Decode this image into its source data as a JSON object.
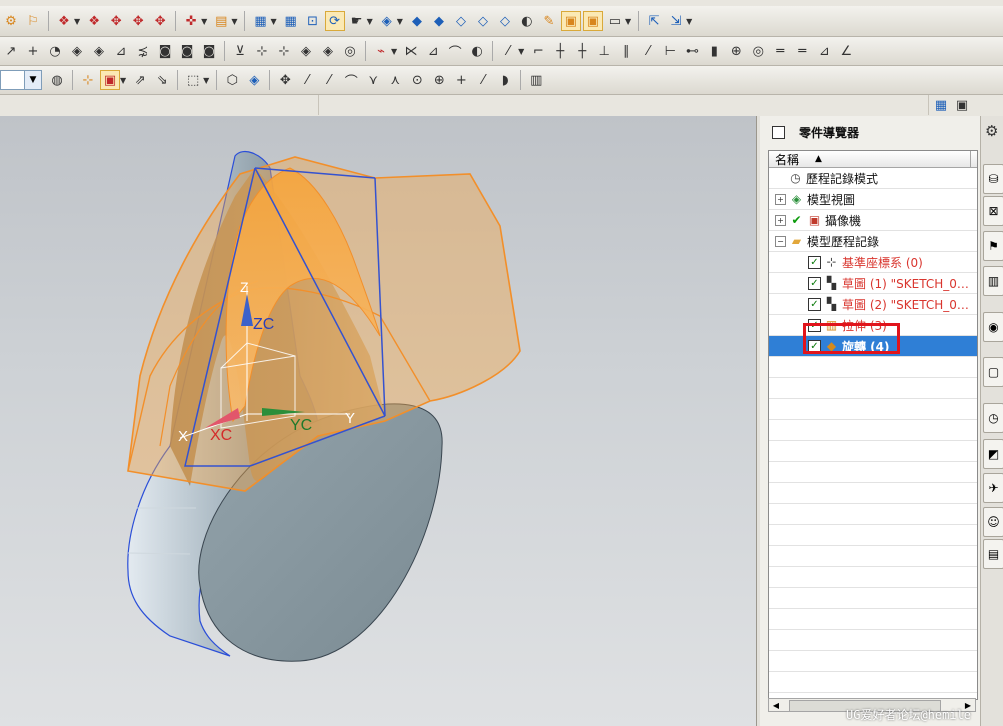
{
  "navigator": {
    "title": "零件導覽器",
    "column_name": "名稱",
    "sort_indicator": "▲",
    "rows": [
      {
        "label": "歷程記錄模式",
        "icon": "clock-icon",
        "expand": "",
        "checked": false,
        "style": "normal"
      },
      {
        "label": "模型視圖",
        "icon": "model-views-icon",
        "expand": "+",
        "checked": false,
        "style": "normal"
      },
      {
        "label": "攝像機",
        "icon": "camera-icon",
        "expand": "+",
        "checked": false,
        "style": "normal"
      },
      {
        "label": "模型歷程記錄",
        "icon": "folder-open-icon",
        "expand": "−",
        "checked": false,
        "style": "normal"
      },
      {
        "label": "基準座標系 (0)",
        "icon": "datum-csys-icon",
        "expand": "",
        "checked": true,
        "style": "red"
      },
      {
        "label": "草圖 (1) \"SKETCH_0…",
        "icon": "sketch-icon",
        "expand": "",
        "checked": true,
        "style": "red"
      },
      {
        "label": "草圖 (2) \"SKETCH_0…",
        "icon": "sketch-icon",
        "expand": "",
        "checked": true,
        "style": "red"
      },
      {
        "label": "拉伸 (3)",
        "icon": "extrude-icon",
        "expand": "",
        "checked": true,
        "style": "red"
      },
      {
        "label": "旋轉 (4)",
        "icon": "revolve-icon",
        "expand": "",
        "checked": true,
        "style": "selected"
      }
    ]
  },
  "viewport": {
    "axis_zc": "ZC",
    "axis_xc": "XC",
    "axis_yc": "YC",
    "axis_x": "X",
    "axis_y": "Y",
    "axis_z": "Z"
  },
  "watermark": "UG爱好者论坛@hemile",
  "colors": {
    "accent_selected": "#2f7fd6",
    "highlight_box": "#e1141b",
    "feature_red_text": "#d9352e",
    "revolve_preview": "#f2a64a",
    "solid_body": "#8a9aa2"
  }
}
